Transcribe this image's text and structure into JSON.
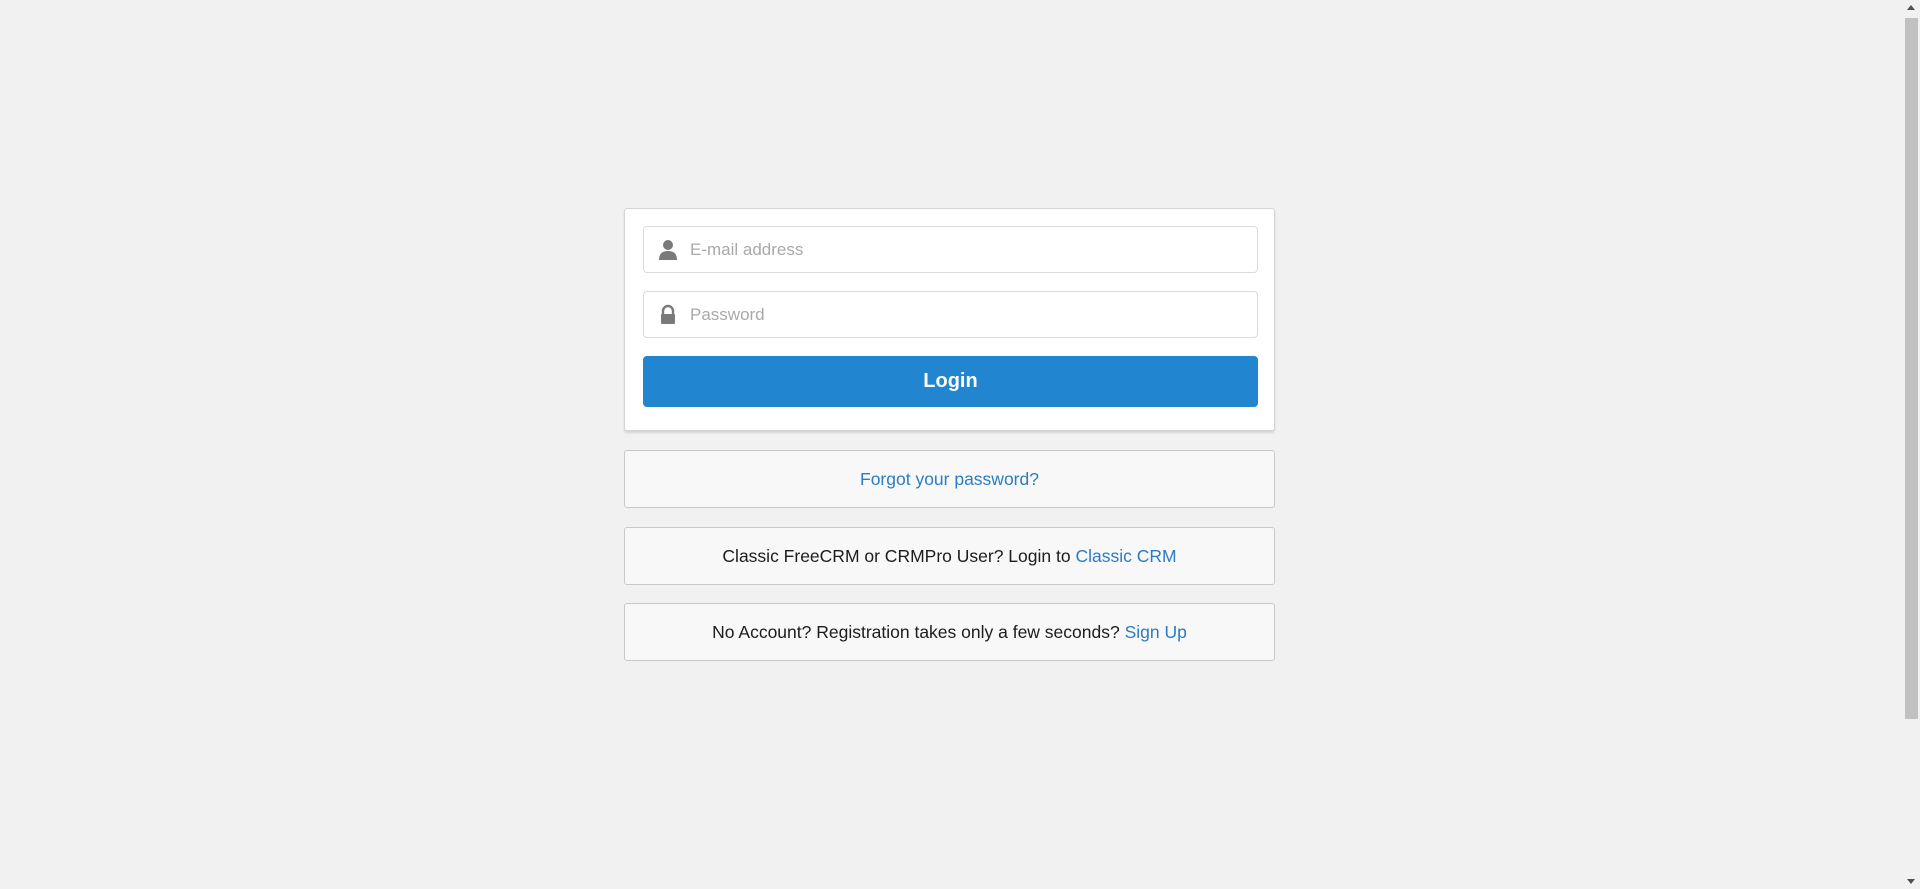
{
  "login_form": {
    "email_placeholder": "E-mail address",
    "email_value": "",
    "password_placeholder": "Password",
    "password_value": "",
    "login_label": "Login",
    "email_icon": "user-icon",
    "password_icon": "lock-icon"
  },
  "forgot": {
    "link_text": "Forgot your password?"
  },
  "classic": {
    "text": "Classic FreeCRM or CRMPro User? Login to",
    "link_text": "Classic CRM"
  },
  "signup": {
    "text": "No Account? Registration takes only a few seconds?",
    "link_text": "Sign Up"
  },
  "colors": {
    "primary": "#2185d0",
    "link": "#2c7bc3",
    "background": "#f1f1f1"
  }
}
